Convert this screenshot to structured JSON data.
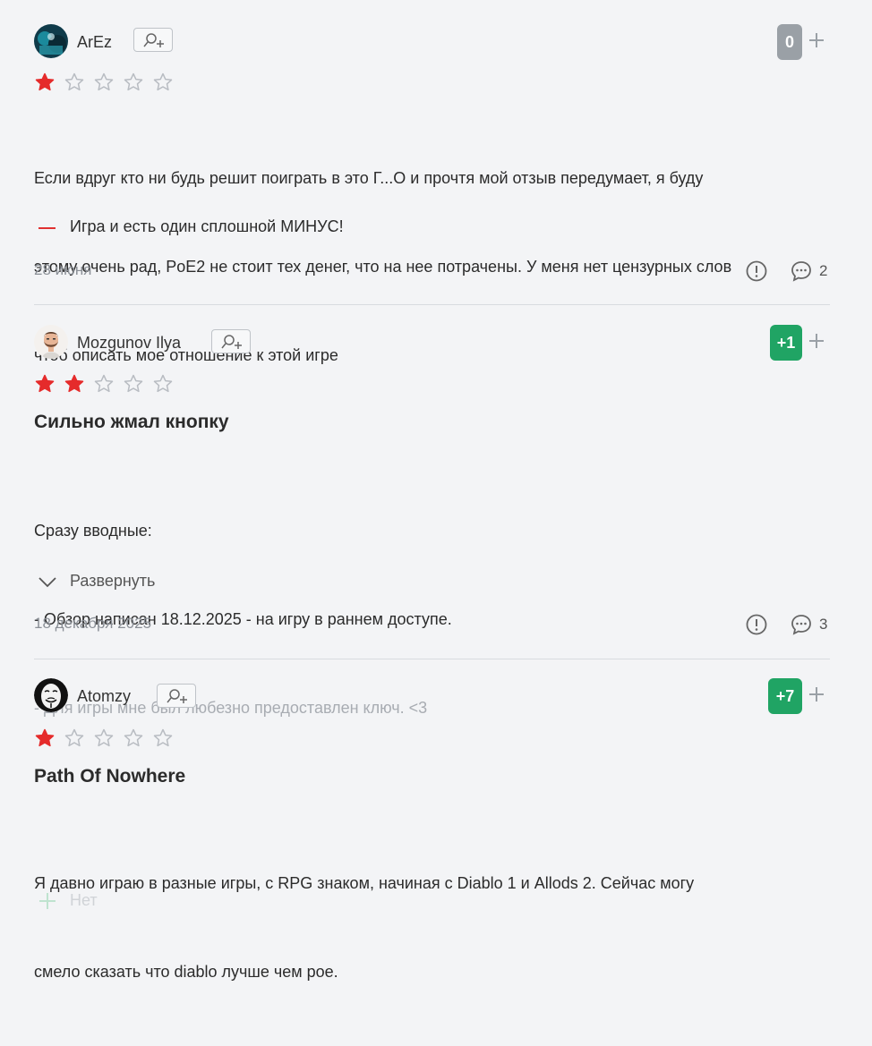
{
  "reviews": [
    {
      "username": "ArEz",
      "score": "0",
      "rating": 1,
      "title": "",
      "body_lines": [
        "Если вдруг кто ни будь решит поиграть в это Г...О и прочтя мой отзыв передумает, я буду",
        "этому очень рад, PoE2 не стоит тех денег, что на нее потрачены. У меня нет цензурных слов",
        "чтоб описать мое отношение к этой игре"
      ],
      "minus": "Игра и есть один сплошной МИНУС!",
      "date": "28 июня",
      "comments": "2"
    },
    {
      "username": "Mozgunov Ilya",
      "score": "+1",
      "rating": 2,
      "title": "Сильно жмал кнопку",
      "body_lines": [
        "Сразу вводные:",
        "- Обзор написан 18.12.2025 - на игру в раннем доступе.",
        "- Для игры мне был любезно предоставлен ключ. <3"
      ],
      "expand_label": "Развернуть",
      "date": "18 декабря 2025",
      "comments": "3"
    },
    {
      "username": "Atomzy",
      "score": "+7",
      "rating": 1,
      "title": "Path Of Nowhere",
      "body_lines": [
        "Я давно играю в разные игры, с RPG знаком, начиная с Diablo 1 и Allods 2. Сейчас могу",
        "смело сказать что diablo лучше чем рое."
      ],
      "plus_label": "Нет"
    }
  ],
  "colors": {
    "star_filled": "#e52b2b",
    "star_empty": "#b8bcc2",
    "score_positive": "#20a464",
    "score_neutral": "#9aa0a6",
    "minus_dash": "#e03131",
    "plus_mark": "#20a464"
  },
  "icons": [
    "avatar",
    "follow-user-icon",
    "star-icon",
    "plus-icon",
    "report-icon",
    "comment-icon",
    "chevron-down-icon"
  ]
}
